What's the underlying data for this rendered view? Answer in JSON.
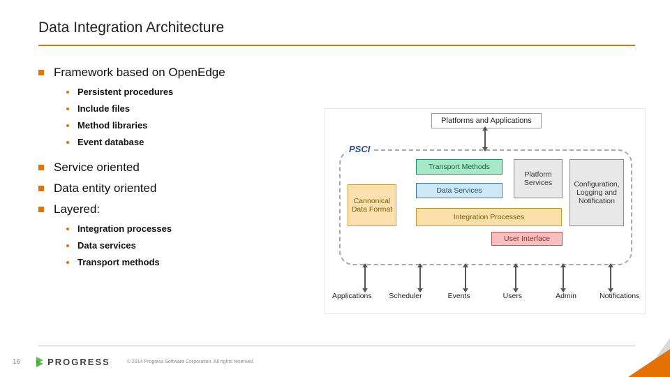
{
  "title": "Data Integration Architecture",
  "bullets": {
    "b1": "Framework based on OpenEdge",
    "b1_subs": {
      "s1": "Persistent procedures",
      "s2": "Include files",
      "s3": "Method libraries",
      "s4": "Event database"
    },
    "b2": "Service oriented",
    "b3": "Data entity oriented",
    "b4": "Layered:",
    "b4_subs": {
      "s1": "Integration processes",
      "s2": "Data services",
      "s3": "Transport methods"
    }
  },
  "diagram": {
    "top": "Platforms and Applications",
    "psci": "PSCI",
    "transport": "Transport Methods",
    "dataservices": "Data Services",
    "intproc": "Integration Processes",
    "ui": "User Interface",
    "platform": "Platform Services",
    "conf": "Configuration, Logging and Notification",
    "canon": "Cannonical Data Format",
    "bottom": {
      "b1": "Applications",
      "b2": "Scheduler",
      "b3": "Events",
      "b4": "Users",
      "b5": "Admin",
      "b6": "Notifications"
    }
  },
  "footer": {
    "page": "16",
    "logo": "PROGRESS",
    "copyright": "© 2014 Progress Software Corporation. All rights reserved."
  },
  "colors": {
    "accent": "#e57200"
  }
}
